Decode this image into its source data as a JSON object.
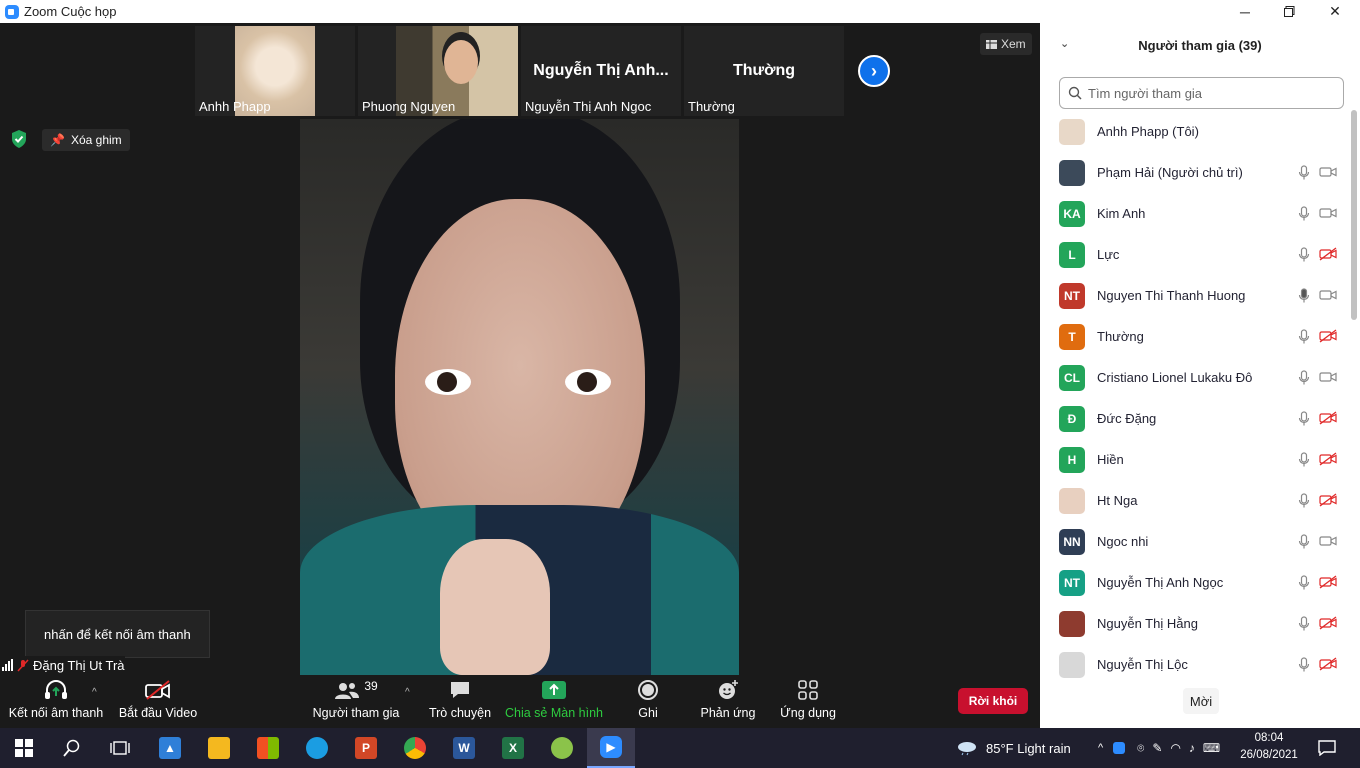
{
  "window": {
    "title": "Zoom Cuộc họp"
  },
  "thumbnails": [
    {
      "name": "Anhh Phapp",
      "type": "video-cat"
    },
    {
      "name": "Phuong Nguyen",
      "type": "video-person"
    },
    {
      "name": "Nguyễn Thị Anh Ngoc",
      "big_name": "Nguyễn Thị Anh...",
      "type": "name-only"
    },
    {
      "name": "Thường",
      "big_name": "Thường",
      "type": "name-only"
    }
  ],
  "view_button": "Xem",
  "unpin_label": "Xóa ghim",
  "audio_tooltip": "nhấn để kết nối âm thanh",
  "self_name": "Đặng Thị Ut Trà",
  "toolbar": {
    "audio": "Kết nối âm thanh",
    "video": "Bắt đầu Video",
    "participants": "Người tham gia",
    "participants_count": "39",
    "chat": "Trò chuyện",
    "share": "Chia sẻ Màn hình",
    "record": "Ghi",
    "reactions": "Phản ứng",
    "apps": "Ứng dụng",
    "leave": "Rời khỏi"
  },
  "panel": {
    "title": "Người tham gia (39)",
    "search_placeholder": "Tìm người tham gia",
    "invite": "Mời",
    "participants": [
      {
        "name": "Anhh Phapp (Tôi)",
        "initials": "",
        "color": "#e8d8c8",
        "mic": "none",
        "cam": "none"
      },
      {
        "name": "Phạm Hải (Người chủ trì)",
        "initials": "",
        "color": "#3c4a5a",
        "mic": "off",
        "cam": "on"
      },
      {
        "name": "Kim Anh",
        "initials": "KA",
        "color": "#23a55a",
        "mic": "off",
        "cam": "on"
      },
      {
        "name": "Lực",
        "initials": "L",
        "color": "#23a55a",
        "mic": "off",
        "cam": "off"
      },
      {
        "name": "Nguyen Thi Thanh Huong",
        "initials": "NT",
        "color": "#c0392b",
        "mic": "on",
        "cam": "on"
      },
      {
        "name": "Thường",
        "initials": "T",
        "color": "#e06c0f",
        "mic": "off",
        "cam": "off"
      },
      {
        "name": "Cristiano Lionel Lukaku Đô",
        "initials": "CL",
        "color": "#23a55a",
        "mic": "off",
        "cam": "on"
      },
      {
        "name": "Đức Đặng",
        "initials": "Đ",
        "color": "#23a55a",
        "mic": "off",
        "cam": "off"
      },
      {
        "name": "Hiền",
        "initials": "H",
        "color": "#23a55a",
        "mic": "off",
        "cam": "off"
      },
      {
        "name": "Ht Nga",
        "initials": "",
        "color": "#e8d0c0",
        "mic": "off",
        "cam": "off"
      },
      {
        "name": "Ngoc nhi",
        "initials": "NN",
        "color": "#2f3e55",
        "mic": "off",
        "cam": "on"
      },
      {
        "name": "Nguyễn Thị Anh Ngọc",
        "initials": "NT",
        "color": "#16a085",
        "mic": "off",
        "cam": "off"
      },
      {
        "name": "Nguyễn Thị Hằng",
        "initials": "",
        "color": "#8e3b2f",
        "mic": "off",
        "cam": "off"
      },
      {
        "name": "Nguyễn Thị Lộc",
        "initials": "",
        "color": "#d8d8d8",
        "mic": "off",
        "cam": "off"
      }
    ]
  },
  "taskbar": {
    "weather": "85°F  Light rain",
    "time": "08:04",
    "date": "26/08/2021"
  }
}
